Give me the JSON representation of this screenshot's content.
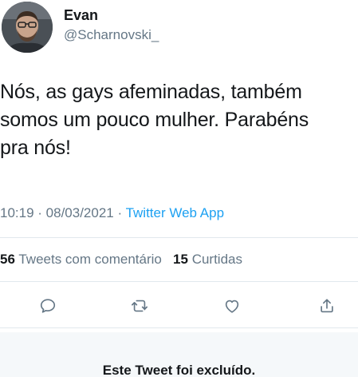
{
  "author": {
    "name": "Evan",
    "handle": "@Scharnovski_"
  },
  "tweet": {
    "text": "Nós, as gays afeminadas, também\nsomos um pouco mulher. Parabéns\npra nós!",
    "time": "10:19",
    "separator1": " · ",
    "date": "08/03/2021",
    "separator2": " · ",
    "source": "Twitter Web App"
  },
  "stats": {
    "quote_count": "56",
    "quote_label": "Tweets com comentário",
    "retweet_count": "15",
    "retweet_label": "Curtidas"
  },
  "actions": [
    {
      "icon": "reply-icon"
    },
    {
      "icon": "retweet-icon"
    },
    {
      "icon": "like-icon"
    },
    {
      "icon": "share-icon"
    }
  ],
  "deleted_notice": "Este Tweet foi excluído.",
  "colors": {
    "text": "#14171a",
    "secondary": "#657786",
    "link": "#1da1f2",
    "divider": "#e1e8ed",
    "banner_bg": "#f5f8fa"
  }
}
